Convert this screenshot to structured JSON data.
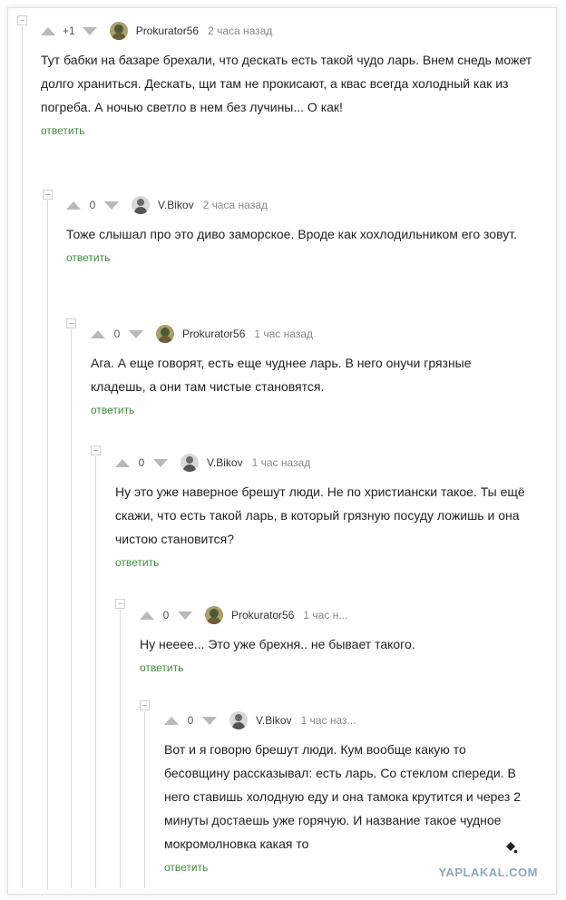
{
  "comments": [
    {
      "rating": "+1",
      "author": "Prokurator56",
      "time": "2 часа назад",
      "text": "Тут бабки на базаре брехали, что дескать есть такой чудо ларь. Внем снедь может долго храниться. Дескать, щи там не прокисают, а квас всегда холодный как из погреба. А ночью светло в нем без лучины... О как!",
      "reply": "ответить"
    },
    {
      "rating": "0",
      "author": "V.Bikov",
      "time": "2 часа назад",
      "text": "Тоже слышал про это диво заморское. Вроде как хохлодильником его зовут.",
      "reply": "ответить"
    },
    {
      "rating": "0",
      "author": "Prokurator56",
      "time": "1 час назад",
      "text": "Ага. А еще говорят, есть еще чуднее ларь. В него онучи грязные кладешь, а они там чистые становятся.",
      "reply": "ответить"
    },
    {
      "rating": "0",
      "author": "V.Bikov",
      "time": "1 час назад",
      "text": "Ну это уже наверное брешут люди. Не по христиански такое. Ты ещё скажи, что есть такой ларь, в который грязную посуду ложишь и она чистою становится?",
      "reply": "ответить"
    },
    {
      "rating": "0",
      "author": "Prokurator56",
      "time": "1 час н...",
      "text": "Ну неeee... Это уже брехня.. не бывает такого.",
      "reply": "ответить"
    },
    {
      "rating": "0",
      "author": "V.Bikov",
      "time": "1 час наз...",
      "text": "Вот и я говорю брешут люди. Кум вообще какую то бесовщину рассказывал: есть ларь. Со стеклом спереди. В него ставишь холодную еду и она тамока крутится и через 2 минуты достаешь уже горячую. И название такое чудное мокромолновка какая то",
      "reply": "ответить"
    }
  ],
  "watermark": "YAPLAKAL.COM",
  "icons": {
    "upvote": "arrow-up-icon",
    "downvote": "arrow-down-icon",
    "collapse": "collapse-thread-icon",
    "corner": "paint-bucket-icon"
  }
}
